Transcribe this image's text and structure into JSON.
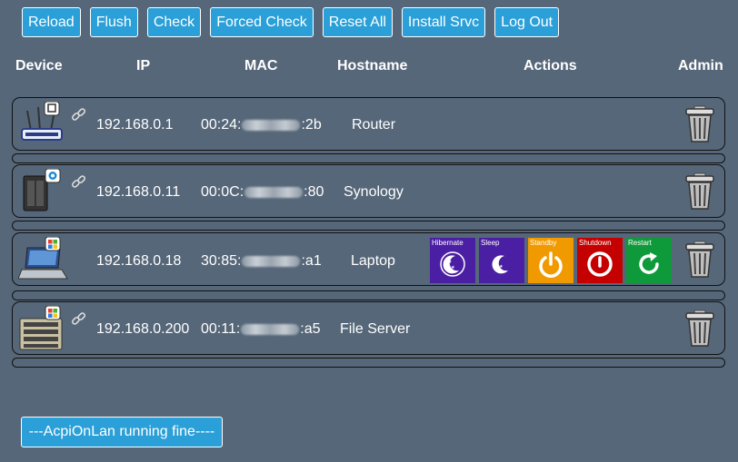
{
  "toolbar": {
    "reload": "Reload",
    "flush": "Flush",
    "check": "Check",
    "forced_check": "Forced Check",
    "reset_all": "Reset All",
    "install_srvc": "Install Srvc",
    "log_out": "Log Out"
  },
  "columns": {
    "device": "Device",
    "ip": "IP",
    "mac": "MAC",
    "hostname": "Hostname",
    "actions": "Actions",
    "admin": "Admin"
  },
  "devices": [
    {
      "ip": "192.168.0.1",
      "mac_prefix": "00:24:",
      "mac_suffix": ":2b",
      "hostname": "Router",
      "icon": "router-icon"
    },
    {
      "ip": "192.168.0.11",
      "mac_prefix": "00:0C:",
      "mac_suffix": ":80",
      "hostname": "Synology",
      "icon": "nas-icon"
    },
    {
      "ip": "192.168.0.18",
      "mac_prefix": "30:85:",
      "mac_suffix": ":a1",
      "hostname": "Laptop",
      "icon": "laptop-icon"
    },
    {
      "ip": "192.168.0.200",
      "mac_prefix": "00:11:",
      "mac_suffix": ":a5",
      "hostname": "File Server",
      "icon": "server-icon"
    }
  ],
  "actions": {
    "hibernate": {
      "label": "Hibernate",
      "color": "#4b1fa4"
    },
    "sleep": {
      "label": "Sleep",
      "color": "#4b1fa4"
    },
    "standby": {
      "label": "Standby",
      "color": "#f19a00"
    },
    "shutdown": {
      "label": "Shutdown",
      "color": "#c40000"
    },
    "restart": {
      "label": "Restart",
      "color": "#0e9a3a"
    }
  },
  "status": {
    "message": "---AcpiOnLan running fine----"
  }
}
